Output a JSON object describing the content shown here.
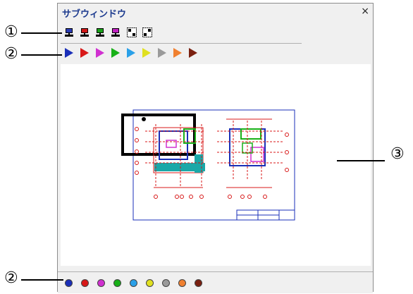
{
  "window": {
    "title": "サブウィンドウ",
    "close_label": "×"
  },
  "callouts": {
    "c1": "①",
    "c2": "②",
    "c3": "③",
    "c2b": "②"
  },
  "toolbar1": {
    "icons": [
      {
        "name": "monitor-icon-blue",
        "color": "#2a3bb5"
      },
      {
        "name": "monitor-icon-red",
        "color": "#d01818"
      },
      {
        "name": "monitor-icon-green",
        "color": "#18a018"
      },
      {
        "name": "monitor-icon-magenta",
        "color": "#c020c0"
      },
      {
        "name": "select-area-icon",
        "color": "#000000"
      },
      {
        "name": "deselect-area-icon",
        "color": "#000000"
      }
    ]
  },
  "toolbar2": {
    "flags": [
      "#1a2fb8",
      "#d81818",
      "#d030d0",
      "#18b018",
      "#2aa0e8",
      "#e0e020",
      "#9a9a9a",
      "#f08030",
      "#7a2010"
    ]
  },
  "palette": {
    "colors": [
      "#1a2fb8",
      "#d81818",
      "#d030d0",
      "#18b018",
      "#2aa0e8",
      "#e0e020",
      "#9a9a9a",
      "#f08030",
      "#7a2010"
    ]
  }
}
